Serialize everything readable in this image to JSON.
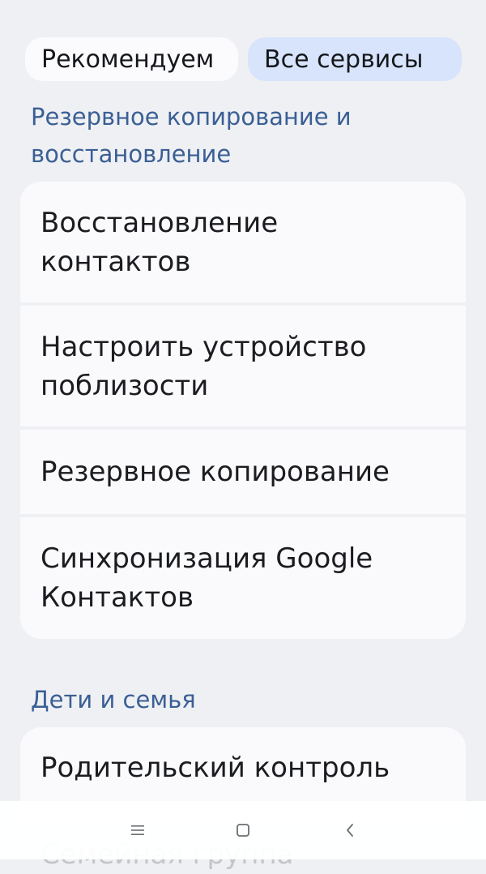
{
  "tabs": {
    "recommended": "Рекомендуем",
    "all_services": "Все сервисы"
  },
  "sections": [
    {
      "title": "Резервное копирование и восстановление",
      "items": [
        {
          "label": "Восстановление контактов"
        },
        {
          "label": "Настроить устройство поблизости"
        },
        {
          "label": "Резервное копирование"
        },
        {
          "label": "Синхронизация Google Контактов"
        }
      ]
    },
    {
      "title": "Дети и семья",
      "items": [
        {
          "label": "Родительский контроль"
        },
        {
          "label": "Семейная группа"
        }
      ]
    }
  ],
  "navbar": {
    "icons": [
      "menu-icon",
      "home-icon",
      "back-icon"
    ]
  },
  "colors": {
    "background": "#eff0f4",
    "section_title": "#3a5f94",
    "active_tab": "#d7e4fb",
    "card": "#fafafc"
  }
}
